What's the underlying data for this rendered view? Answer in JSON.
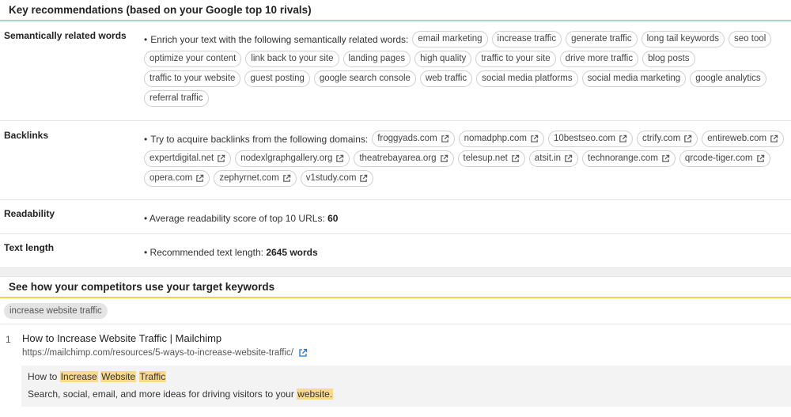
{
  "recommendations": {
    "title": "Key recommendations (based on your Google top 10 rivals)",
    "semantic": {
      "label": "Semantically related words",
      "intro": "Enrich your text with the following semantically related words:",
      "words": [
        "email marketing",
        "increase traffic",
        "generate traffic",
        "long tail keywords",
        "seo tool",
        "optimize your content",
        "link back to your site",
        "landing pages",
        "high quality",
        "traffic to your site",
        "drive more traffic",
        "blog posts",
        "traffic to your website",
        "guest posting",
        "google search console",
        "web traffic",
        "social media platforms",
        "social media marketing",
        "google analytics",
        "referral traffic"
      ]
    },
    "backlinks": {
      "label": "Backlinks",
      "intro": "Try to acquire backlinks from the following domains:",
      "domains": [
        "froggyads.com",
        "nomadphp.com",
        "10bestseo.com",
        "ctrify.com",
        "entireweb.com",
        "expertdigital.net",
        "nodexlgraphgallery.org",
        "theatrebayarea.org",
        "telesup.net",
        "atsit.in",
        "technorange.com",
        "qrcode-tiger.com",
        "opera.com",
        "zephyrnet.com",
        "v1study.com"
      ],
      "link_icon": "external-link-icon"
    },
    "readability": {
      "label": "Readability",
      "text": "Average readability score of top 10 URLs:",
      "value": "60"
    },
    "text_length": {
      "label": "Text length",
      "text": "Recommended text length:",
      "value": "2645 words"
    }
  },
  "competitors": {
    "title": "See how your competitors use your target keywords",
    "keyword": "increase website traffic",
    "results": [
      {
        "rank": "1",
        "title": "How to Increase Website Traffic | Mailchimp",
        "url": "https://mailchimp.com/resources/5-ways-to-increase-website-traffic/",
        "snippet_title_parts": [
          {
            "text": "How to ",
            "hl": false
          },
          {
            "text": "Increase",
            "hl": true
          },
          {
            "text": " ",
            "hl": false
          },
          {
            "text": "Website",
            "hl": true
          },
          {
            "text": " ",
            "hl": false
          },
          {
            "text": "Traffic",
            "hl": true
          }
        ],
        "snippet_desc_parts": [
          {
            "text": "Search, social, email, and more ideas for driving visitors to your ",
            "hl": false
          },
          {
            "text": "website.",
            "hl": true
          }
        ]
      }
    ]
  },
  "colors": {
    "header1_border": "#a8d8bf",
    "header2_border": "#f2cf4a",
    "highlight": "#f8d98e",
    "link_icon": "#1a73e8"
  }
}
